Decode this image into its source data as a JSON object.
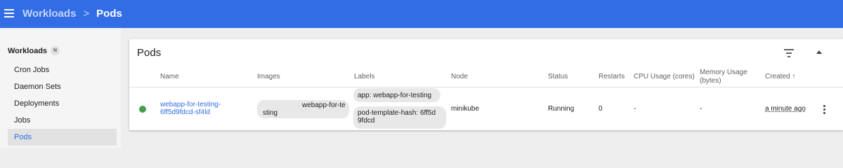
{
  "header": {
    "breadcrumb_parent": "Workloads",
    "breadcrumb_separator": ">",
    "breadcrumb_current": "Pods",
    "menu_icon": "menu-icon",
    "color": "#326de6"
  },
  "sidebar": {
    "section_title": "Workloads",
    "section_badge": "N",
    "items": [
      {
        "label": "Cron Jobs",
        "active": false
      },
      {
        "label": "Daemon Sets",
        "active": false
      },
      {
        "label": "Deployments",
        "active": false
      },
      {
        "label": "Jobs",
        "active": false
      },
      {
        "label": "Pods",
        "active": true
      }
    ]
  },
  "card": {
    "title": "Pods",
    "filter_icon": "filter-icon",
    "collapse_icon": "chevron-up-icon",
    "columns": {
      "name": "Name",
      "images": "Images",
      "labels": "Labels",
      "node": "Node",
      "status": "Status",
      "restarts": "Restarts",
      "cpu": "CPU Usage (cores)",
      "memory_line1": "Memory Usage",
      "memory_line2": "(bytes)",
      "created": "Created ↑"
    },
    "rows": [
      {
        "status_color": "#43a047",
        "name_line1": "webapp-for-testing-",
        "name_line2": "6ff5d9fdcd-sf4ld",
        "image_line1": "webapp-for-te",
        "image_line2": "sting",
        "label1": "app: webapp-for-testing",
        "label2_line1": "pod-template-hash: 6ff5d",
        "label2_line2": "9fdcd",
        "node": "minikube",
        "status": "Running",
        "restarts": "0",
        "cpu": "-",
        "memory": "-",
        "created": "a minute ago",
        "actions_icon": "more-vert-icon"
      }
    ]
  }
}
